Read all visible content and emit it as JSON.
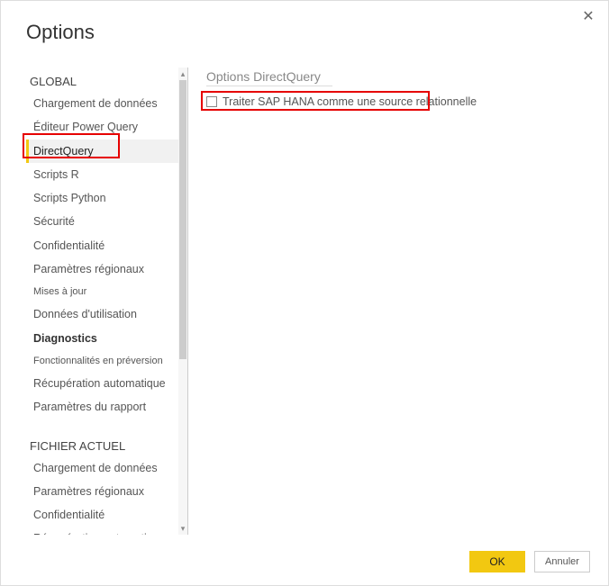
{
  "window": {
    "title": "Options"
  },
  "sidebar": {
    "global_label": "GLOBAL",
    "global_items": [
      "Chargement de données",
      "Éditeur Power Query",
      "DirectQuery",
      "Scripts R",
      "Scripts Python",
      "Sécurité",
      "Confidentialité",
      "Paramètres régionaux",
      "Mises à jour",
      "Données d'utilisation",
      "Diagnostics",
      "Fonctionnalités en préversion",
      "Récupération automatique",
      "Paramètres du rapport"
    ],
    "selected_index": 2,
    "current_file_label": "FICHIER ACTUEL",
    "current_file_items": [
      "Chargement de données",
      "Paramètres régionaux",
      "Confidentialité",
      "Récupération automatique"
    ]
  },
  "panel": {
    "title": "Options DirectQuery",
    "checkbox_label": "Traiter SAP HANA comme une source relationnelle",
    "checkbox_checked": false
  },
  "buttons": {
    "ok": "OK",
    "cancel": "Annuler"
  },
  "colors": {
    "accent": "#f2c811",
    "highlight": "#e60000"
  }
}
